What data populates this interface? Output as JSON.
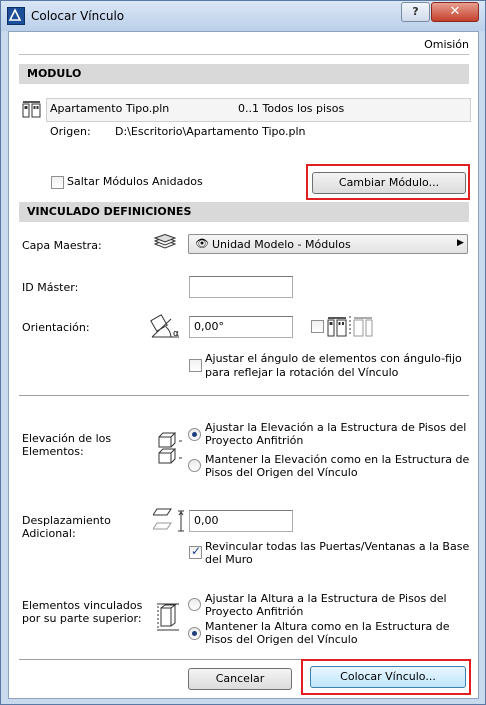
{
  "window": {
    "title": "Colocar Vínculo",
    "help": "?",
    "close": "✕"
  },
  "header": {
    "omission": "Omisión"
  },
  "module_section": {
    "header": "MODULO",
    "file_name": "Apartamento Tipo.pln",
    "stories": "0..1 Todos los pisos",
    "origin_label": "Origen:",
    "origin_path": "D:\\Escritorio\\Apartamento Tipo.pln",
    "skip_nested_label": "Saltar Módulos Anidados",
    "skip_nested_checked": false,
    "change_module_button": "Cambiar Módulo..."
  },
  "link_section": {
    "header": "VINCULADO DEFINICIONES",
    "master_layer_label": "Capa Maestra:",
    "master_layer_value": "Unidad Modelo - Módulos",
    "master_id_label": "ID Máster:",
    "master_id_value": "",
    "orientation_label": "Orientación:",
    "orientation_value": "0,00°",
    "mirror_checked": false,
    "adjust_angle_label": "Ajustar el ángulo de elementos con ángulo-fijo para reflejar la rotación del Vínculo",
    "adjust_angle_checked": false,
    "elevation_label": "Elevación de los Elementos:",
    "elevation_opt1": "Ajustar la Elevación a la Estructura de Pisos del Proyecto Anfitrión",
    "elevation_opt2": "Mantener la Elevación como en la Estructura de Pisos del Origen del Vínculo",
    "elevation_selected": 1,
    "offset_label": "Desplazamiento Adicional:",
    "offset_value": "0,00",
    "relink_label": "Revincular todas las Puertas/Ventanas a la Base del Muro",
    "relink_checked": true,
    "top_linked_label": "Elementos vinculados por su parte superior:",
    "top_opt1": "Ajustar la Altura a la Estructura de Pisos del Proyecto Anfitrión",
    "top_opt2": "Mantener la Altura como en la Estructura de Pisos del Origen del Vínculo",
    "top_selected": 2
  },
  "footer": {
    "cancel": "Cancelar",
    "place_link": "Colocar Vínculo..."
  },
  "colors": {
    "highlight": "#e02020",
    "section_bg": "#d9d9d9"
  }
}
